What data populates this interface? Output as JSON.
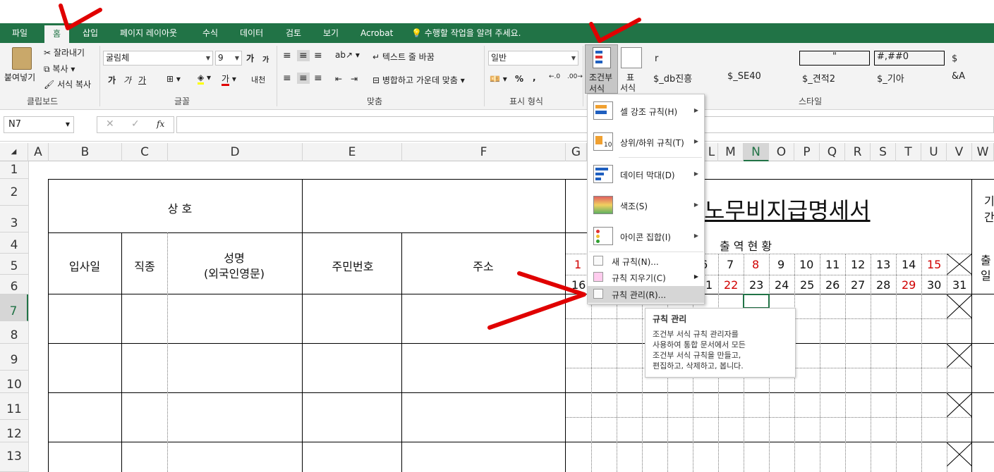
{
  "tabs": [
    "파일",
    "홈",
    "삽입",
    "페이지 레이아웃",
    "수식",
    "데이터",
    "검토",
    "보기",
    "Acrobat"
  ],
  "tellme": "수행할 작업을 알려 주세요.",
  "clipboard": {
    "paste": "붙여넣기",
    "cut": "잘라내기",
    "copy": "복사",
    "format_painter": "서식 복사",
    "label": "클립보드"
  },
  "font": {
    "name": "굴림체",
    "size": "9",
    "label": "글꼴",
    "bold": "가",
    "italic": "가",
    "underline": "가",
    "grow": "가",
    "shrink": "가",
    "fontcolor": "가",
    "phonetic": "내천"
  },
  "align": {
    "wrap": "텍스트 줄 바꿈",
    "merge": "병합하고 가운데 맞춤",
    "label": "맞춤"
  },
  "number": {
    "format": "일반",
    "percent": "%",
    "comma": ",",
    "label": "표시 형식"
  },
  "cond": {
    "line1": "조건부",
    "line2": "서식"
  },
  "table_fmt": {
    "line1": "표",
    "line2": "서식"
  },
  "styles": {
    "label": "스타일",
    "row1": [
      "r",
      "\"",
      "#,##0",
      "$"
    ],
    "row2": [
      "$_db진흥",
      "$_SE40",
      "$_견적2",
      "$_기아",
      "&A"
    ]
  },
  "namebox": "N7",
  "fx": "fx",
  "columns": [
    "A",
    "B",
    "C",
    "D",
    "E",
    "F",
    "G",
    "L",
    "M",
    "N",
    "O",
    "P",
    "Q",
    "R",
    "S",
    "T",
    "U",
    "V",
    "W"
  ],
  "rows": [
    "1",
    "2",
    "3",
    "4",
    "5",
    "6",
    "7",
    "8",
    "9",
    "10",
    "11",
    "12",
    "13"
  ],
  "sheet": {
    "sangho": "상  호",
    "title": "노무비지급명세서",
    "ipsa": "입사일",
    "jikjong": "직종",
    "name1": "성명",
    "name2": "(외국인영문)",
    "jumin": "주민번호",
    "juso": "주소",
    "chul": "출   역   현   황",
    "right1": "출",
    "right2": "일",
    "right3": "기",
    "right4": "간",
    "days1": [
      "1",
      "6",
      "7",
      "8",
      "9",
      "10",
      "11",
      "12",
      "13",
      "14",
      "15"
    ],
    "days2": [
      "16",
      "1",
      "22",
      "23",
      "24",
      "25",
      "26",
      "27",
      "28",
      "29",
      "30",
      "31"
    ]
  },
  "menu": {
    "items": [
      "셀 강조 규칙(H)",
      "상위/하위 규칙(T)",
      "데이터 막대(D)",
      "색조(S)",
      "아이콘 집합(I)"
    ],
    "small": [
      "새 규칙(N)...",
      "규칙 지우기(C)",
      "규칙 관리(R)..."
    ]
  },
  "tip": {
    "title": "규칙 관리",
    "body": "조건부 서식 규칙 관리자를\n사용하여 통합 문서에서 모든\n조건부 서식 규칙을 만들고,\n편집하고, 삭제하고, 봅니다."
  },
  "colors": {
    "excel_green": "#217346",
    "annotation": "#e00000",
    "red_text": "#d00000"
  }
}
